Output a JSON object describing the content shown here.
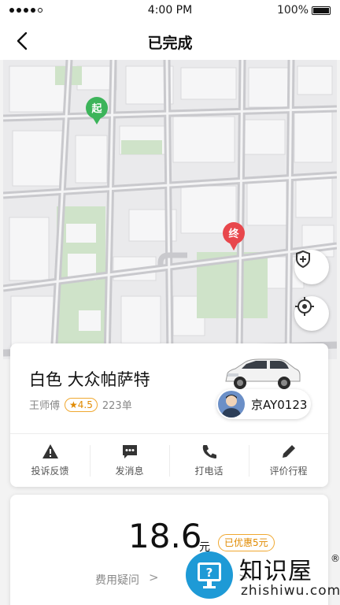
{
  "status_bar": {
    "time": "4:00 PM",
    "battery": "100%"
  },
  "nav": {
    "title": "已完成"
  },
  "map": {
    "start_label": "起",
    "end_label": "终",
    "start_color": "#3cb45a",
    "end_color": "#e8474c",
    "park_color": "#cfe3c9",
    "shield_icon": "shield-plus-icon",
    "locate_icon": "locate-icon"
  },
  "trip": {
    "car_name": "白色 大众帕萨特",
    "driver_name": "王师傅",
    "rating": "4.5",
    "order_count": "223单",
    "plate": "京AY0123"
  },
  "actions": [
    {
      "label": "投诉反馈",
      "icon": "warning-icon"
    },
    {
      "label": "发消息",
      "icon": "message-icon"
    },
    {
      "label": "打电话",
      "icon": "phone-icon"
    },
    {
      "label": "评价行程",
      "icon": "pencil-icon"
    }
  ],
  "fare": {
    "amount": "18.6",
    "unit": "元",
    "discount": "已优惠5元",
    "question": "费用疑问"
  },
  "watermark": {
    "name": "知识屋",
    "reg": "®",
    "url": "zhishiwu.com",
    "color": "#1e9ad6"
  }
}
